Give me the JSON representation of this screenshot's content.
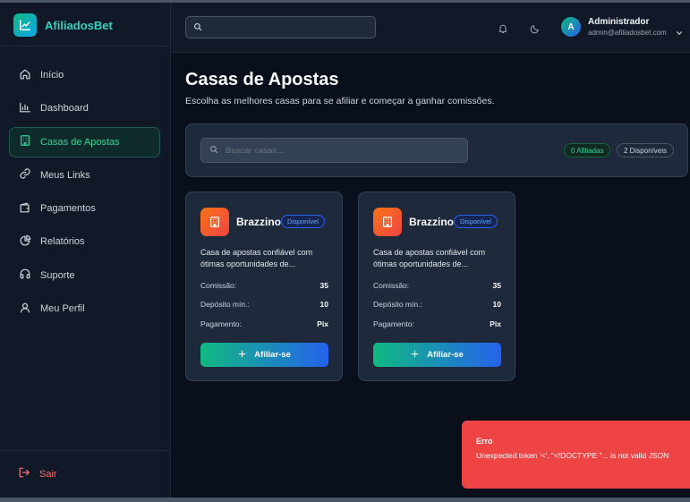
{
  "brand": {
    "name": "AfiliadosBet",
    "logo_icon": "trending-chart-icon"
  },
  "sidebar": {
    "items": [
      {
        "label": "Início",
        "icon": "home-icon",
        "active": false
      },
      {
        "label": "Dashboard",
        "icon": "bar-chart-icon",
        "active": false
      },
      {
        "label": "Casas de Apostas",
        "icon": "building-icon",
        "active": true
      },
      {
        "label": "Meus Links",
        "icon": "link-icon",
        "active": false
      },
      {
        "label": "Pagamentos",
        "icon": "wallet-icon",
        "active": false
      },
      {
        "label": "Relatórios",
        "icon": "pie-chart-icon",
        "active": false
      },
      {
        "label": "Suporte",
        "icon": "headphones-icon",
        "active": false
      },
      {
        "label": "Meu Perfil",
        "icon": "user-icon",
        "active": false
      }
    ],
    "logout_label": "Sair"
  },
  "header": {
    "search_value": "",
    "user": {
      "initial": "A",
      "name": "Administrador",
      "email": "admin@afiliadosbet.com"
    }
  },
  "main": {
    "title": "Casas de Apostas",
    "subtitle": "Escolha as melhores casas para se afiliar e começar a ganhar comissões.",
    "filter": {
      "search_placeholder": "Buscar casas...",
      "affiliated_badge": "0 Afiliadas",
      "available_badge": "2 Disponíveis"
    },
    "cards": [
      {
        "name": "Brazzino",
        "status": "Disponível",
        "description": "Casa de apostas confiável com ótimas oportunidades de...",
        "commission_label": "Comissão:",
        "commission_value": "35",
        "deposit_label": "Depósito mín.:",
        "deposit_value": "10",
        "payment_label": "Pagamento:",
        "payment_value": "Pix",
        "button_label": "Afiliar-se"
      },
      {
        "name": "Brazzino",
        "status": "Disponível",
        "description": "Casa de apostas confiável com ótimas oportunidades de...",
        "commission_label": "Comissão:",
        "commission_value": "35",
        "deposit_label": "Depósito mín.:",
        "deposit_value": "10",
        "payment_label": "Pagamento:",
        "payment_value": "Pix",
        "button_label": "Afiliar-se"
      }
    ]
  },
  "toast": {
    "title": "Erro",
    "message": "Unexpected token '<', \"<!DOCTYPE \"... is not valid JSON"
  },
  "colors": {
    "accent": "#34d399",
    "background": "#0a0f1c",
    "sidebar": "#111827",
    "card": "#1e293b",
    "error": "#ef4444",
    "status_blue": "#60a5fa"
  }
}
